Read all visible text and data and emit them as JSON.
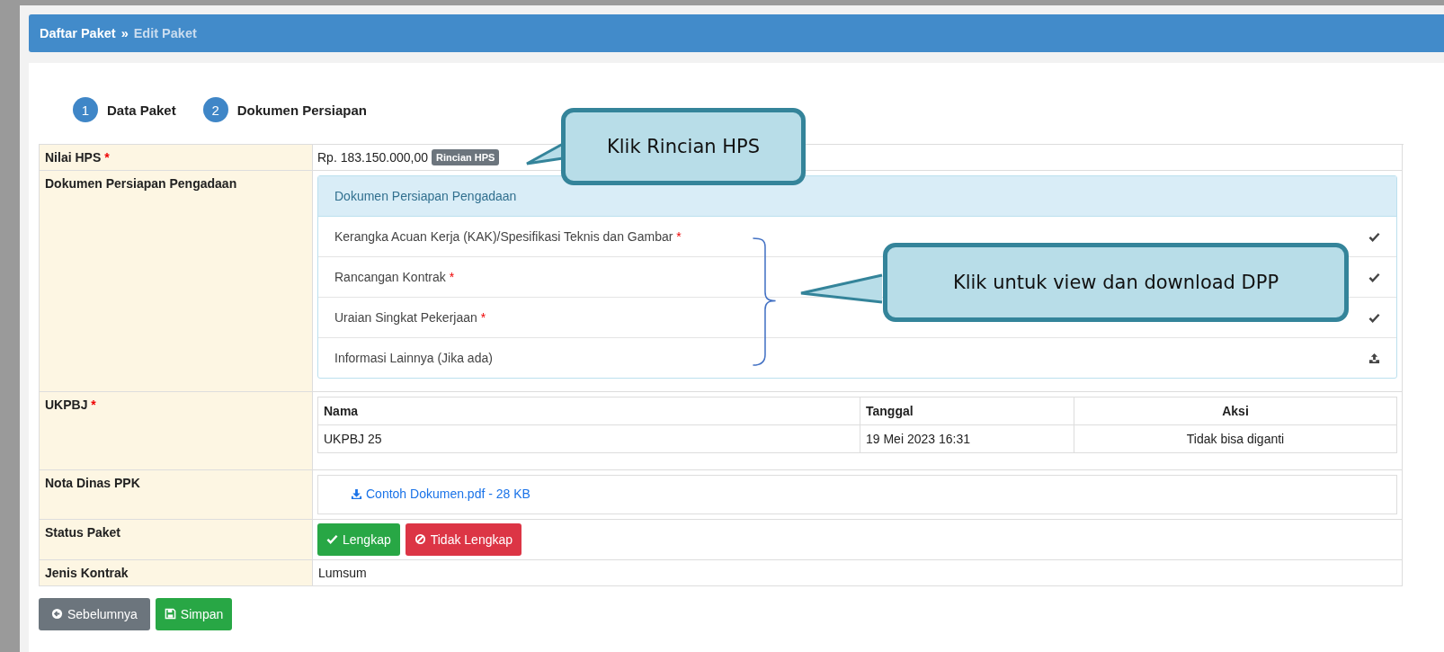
{
  "breadcrumb": [
    {
      "label": "Daftar Paket",
      "current": false
    },
    {
      "label": "»",
      "current": false
    },
    {
      "label": "Edit Paket",
      "current": true
    }
  ],
  "steps": [
    {
      "number": "1",
      "label": "Data Paket"
    },
    {
      "number": "2",
      "label": "Dokumen Persiapan"
    }
  ],
  "nilai_hps": {
    "label": "Nilai HPS",
    "required_mark": "*",
    "value": "Rp. 183.150.000,00",
    "button": "Rincian HPS"
  },
  "dokumen": {
    "label": "Dokumen Persiapan Pengadaan",
    "panel_title": "Dokumen Persiapan Pengadaan",
    "items": [
      {
        "name": "Kerangka Acuan Kerja (KAK)/Spesifikasi Teknis dan Gambar",
        "required_mark": "*",
        "kind": "uploaded"
      },
      {
        "name": "Rancangan Kontrak",
        "required_mark": "*",
        "kind": "uploaded"
      },
      {
        "name": "Uraian Singkat Pekerjaan",
        "required_mark": "*",
        "kind": "uploaded"
      },
      {
        "name": "Informasi Lainnya (Jika ada)",
        "kind": "upload"
      }
    ]
  },
  "ukpbj": {
    "label": "UKPBJ",
    "required_mark": "*",
    "columns": [
      "Nama",
      "Tanggal",
      "Aksi"
    ],
    "rows": [
      [
        "UKPBJ 25",
        "19 Mei 2023 16:31",
        "Tidak bisa diganti"
      ]
    ]
  },
  "nota_dinas": {
    "label": "Nota Dinas PPK",
    "file": "Contoh Dokumen.pdf - 28 KB"
  },
  "status_paket": {
    "label": "Status Paket",
    "buttons": [
      {
        "label": "Lengkap",
        "kind": "ok"
      },
      {
        "label": "Tidak Lengkap",
        "kind": "no"
      }
    ]
  },
  "jenis_kontrak": {
    "label": "Jenis Kontrak",
    "value": "Lumsum"
  },
  "footer_buttons": [
    {
      "label": "Sebelumnya",
      "kind": "back"
    },
    {
      "label": "Simpan",
      "kind": "save"
    }
  ],
  "callouts": [
    "Klik Rincian HPS",
    "Klik untuk view dan download DPP"
  ]
}
